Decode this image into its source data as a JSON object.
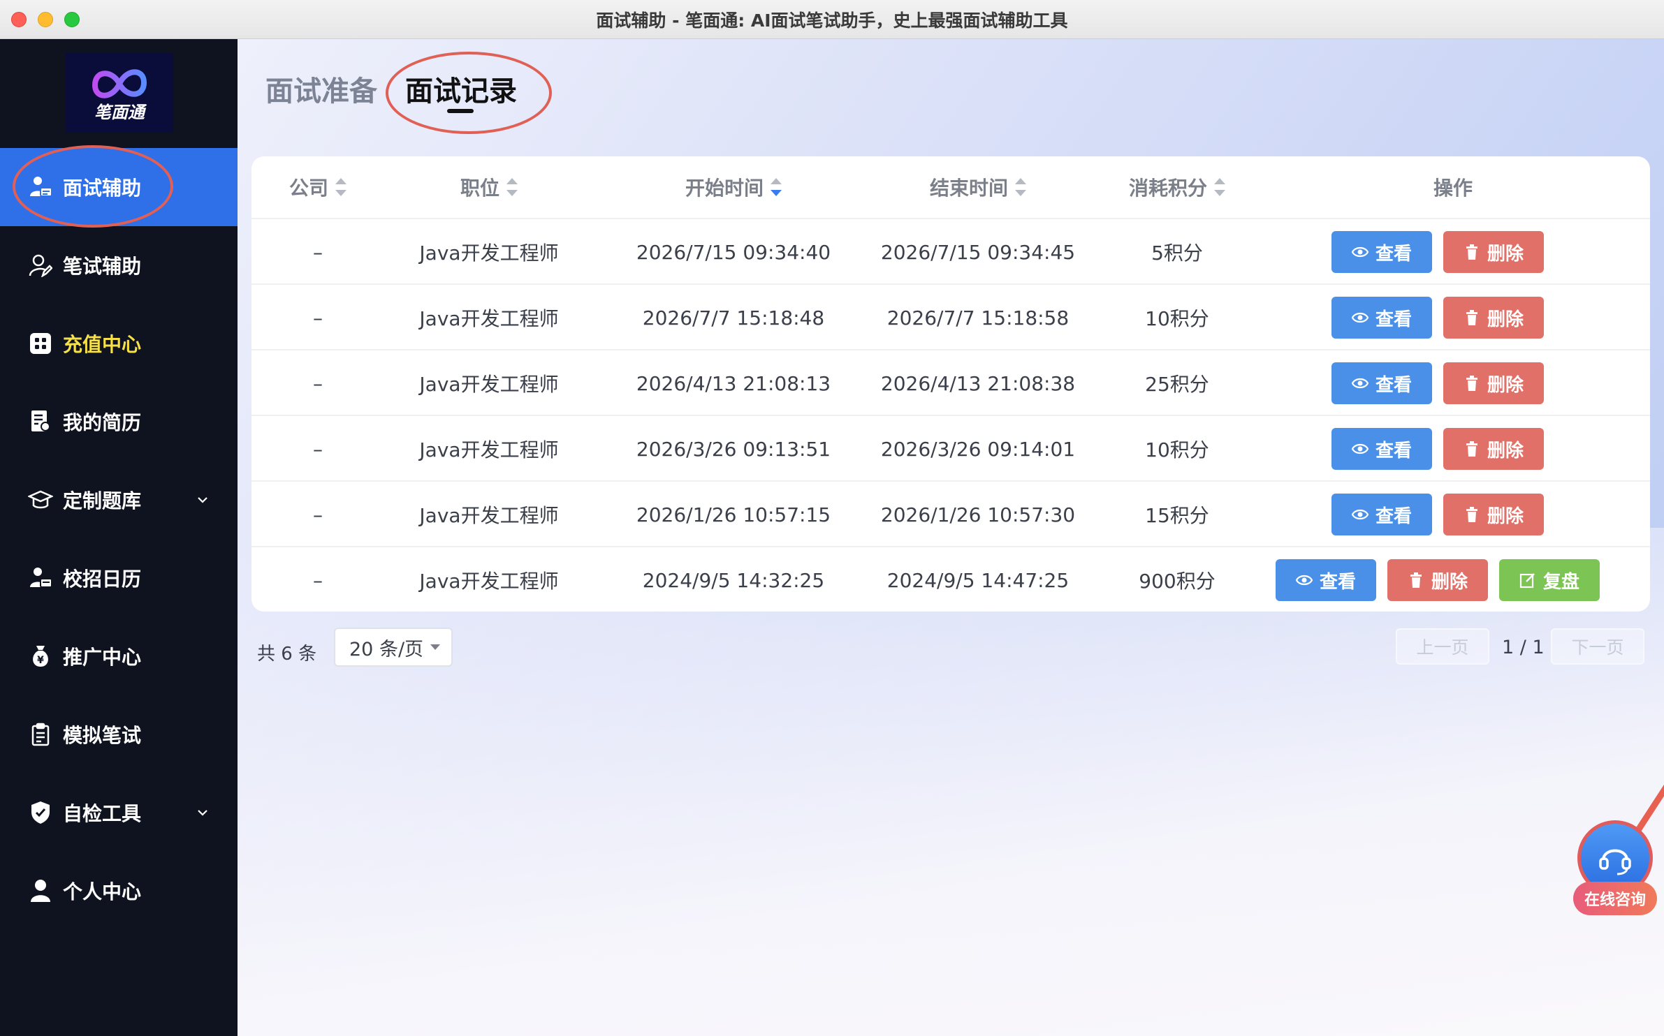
{
  "window": {
    "title": "面试辅助 - 笔面通: AI面试笔试助手，史上最强面试辅助工具"
  },
  "logo": {
    "text": "笔面通"
  },
  "sidebar": {
    "items": [
      {
        "label": "面试辅助",
        "icon": "user-id-icon",
        "active": true
      },
      {
        "label": "笔试辅助",
        "icon": "user-edit-icon"
      },
      {
        "label": "充值中心",
        "icon": "grid-icon",
        "highlight_color": "#f5e04a"
      },
      {
        "label": "我的简历",
        "icon": "resume-icon"
      },
      {
        "label": "定制题库",
        "icon": "graduation-cap-icon",
        "has_submenu": true
      },
      {
        "label": "校招日历",
        "icon": "calendar-user-icon"
      },
      {
        "label": "推广中心",
        "icon": "money-bag-icon"
      },
      {
        "label": "模拟笔试",
        "icon": "clipboard-icon"
      },
      {
        "label": "自检工具",
        "icon": "shield-check-icon",
        "has_submenu": true
      },
      {
        "label": "个人中心",
        "icon": "person-icon"
      }
    ]
  },
  "tabs": [
    {
      "label": "面试准备",
      "active": false
    },
    {
      "label": "面试记录",
      "active": true
    }
  ],
  "table": {
    "columns": [
      "公司",
      "职位",
      "开始时间",
      "结束时间",
      "消耗积分",
      "操作"
    ],
    "rows": [
      {
        "company": "–",
        "position": "Java开发工程师",
        "start": "2026/7/15 09:34:40",
        "end": "2026/7/15 09:34:45",
        "points": "5积分"
      },
      {
        "company": "–",
        "position": "Java开发工程师",
        "start": "2026/7/7 15:18:48",
        "end": "2026/7/7 15:18:58",
        "points": "10积分"
      },
      {
        "company": "–",
        "position": "Java开发工程师",
        "start": "2026/4/13 21:08:13",
        "end": "2026/4/13 21:08:38",
        "points": "25积分"
      },
      {
        "company": "–",
        "position": "Java开发工程师",
        "start": "2026/3/26 09:13:51",
        "end": "2026/3/26 09:14:01",
        "points": "10积分"
      },
      {
        "company": "–",
        "position": "Java开发工程师",
        "start": "2026/1/26 10:57:15",
        "end": "2026/1/26 10:57:30",
        "points": "15积分"
      },
      {
        "company": "–",
        "position": "Java开发工程师",
        "start": "2024/9/5 14:32:25",
        "end": "2024/9/5 14:47:25",
        "points": "900积分"
      }
    ],
    "actions": {
      "view": "查看",
      "delete": "删除",
      "review": "复盘"
    }
  },
  "pagination": {
    "total_text": "共 6 条",
    "page_size": "20 条/页",
    "prev": "上一页",
    "next": "下一页",
    "page_info": "1 / 1"
  },
  "consult": {
    "label": "在线咨询"
  },
  "colors": {
    "sidebar_bg": "#0f1320",
    "active_nav": "#2f6fe8",
    "view_btn": "#4a90e8",
    "delete_btn": "#e07068",
    "review_btn": "#7cc454",
    "annotation": "#e06055"
  }
}
